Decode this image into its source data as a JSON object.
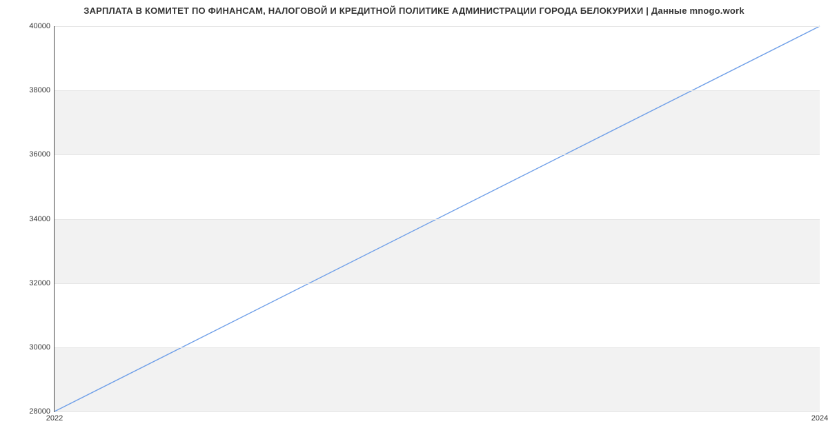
{
  "chart_data": {
    "type": "line",
    "title": "ЗАРПЛАТА В КОМИТЕТ ПО ФИНАНСАМ, НАЛОГОВОЙ И КРЕДИТНОЙ ПОЛИТИКЕ АДМИНИСТРАЦИИ ГОРОДА БЕЛОКУРИХИ | Данные mnogo.work",
    "xlabel": "",
    "ylabel": "",
    "x_ticks": [
      "2022",
      "2024"
    ],
    "y_ticks": [
      28000,
      30000,
      32000,
      34000,
      36000,
      38000,
      40000
    ],
    "ylim": [
      28000,
      40000
    ],
    "xlim": [
      2022,
      2024
    ],
    "series": [
      {
        "name": "salary",
        "color": "#6f9fe8",
        "x": [
          2022,
          2024
        ],
        "y": [
          28000,
          40000
        ]
      }
    ],
    "bands_alternate": true
  }
}
